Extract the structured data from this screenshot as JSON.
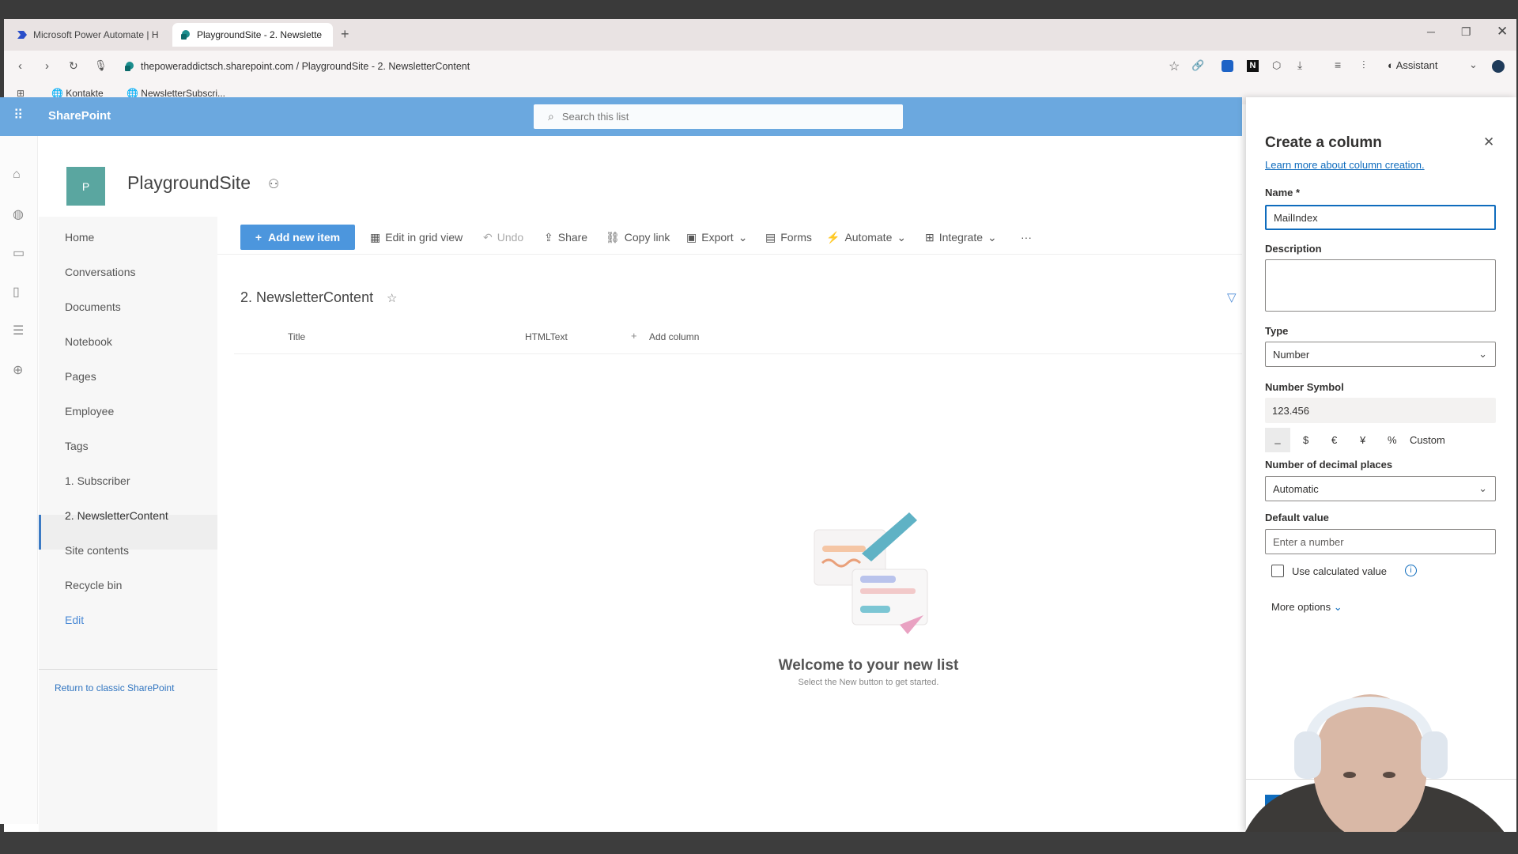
{
  "browser": {
    "tabs": [
      {
        "label": "Microsoft Power Automate | H",
        "icon": "power-automate-icon"
      },
      {
        "label": "PlaygroundSite - 2. Newslette",
        "icon": "sharepoint-icon"
      }
    ],
    "address": "thepoweraddictsch.sharepoint.com / PlaygroundSite - 2. NewsletterContent",
    "assistant_label": "Assistant",
    "bookmarks": [
      "Kontakte",
      "NewsletterSubscri..."
    ]
  },
  "sharepoint": {
    "app_name": "SharePoint",
    "search_placeholder": "Search this list",
    "site_initial": "P",
    "site_title": "PlaygroundSite"
  },
  "leftnav": {
    "items": [
      "Home",
      "Conversations",
      "Documents",
      "Notebook",
      "Pages",
      "Employee",
      "Tags",
      "1. Subscriber",
      "2. NewsletterContent",
      "Site contents",
      "Recycle bin",
      "Edit"
    ],
    "return_link": "Return to classic SharePoint"
  },
  "commandbar": {
    "add_new_item": "Add new item",
    "edit_grid": "Edit in grid view",
    "undo": "Undo",
    "share": "Share",
    "copy_link": "Copy link",
    "export": "Export",
    "forms": "Forms",
    "automate": "Automate",
    "integrate": "Integrate",
    "more": "···"
  },
  "list": {
    "title": "2. NewsletterContent",
    "columns": [
      "Title",
      "HTMLText"
    ],
    "add_column": "Add column",
    "empty_title": "Welcome to your new list",
    "empty_subtitle": "Select the New button to get started."
  },
  "panel": {
    "title": "Create a column",
    "learn_more": "Learn more about column creation.",
    "name_label": "Name *",
    "name_value": "MailIndex",
    "description_label": "Description",
    "type_label": "Type",
    "type_value": "Number",
    "symbol_label": "Number Symbol",
    "symbol_preview": "123.456",
    "symbols": [
      "_",
      "$",
      "€",
      "¥",
      "%",
      "Custom"
    ],
    "decimal_label": "Number of decimal places",
    "decimal_value": "Automatic",
    "default_label": "Default value",
    "default_placeholder": "Enter a number",
    "calculated_label": "Use calculated value",
    "more_options": "More options"
  },
  "colors": {
    "accent": "#4c96dd",
    "header": "#6ba8df",
    "link": "#0f6cbd",
    "site_tile": "#5aa6a0"
  }
}
